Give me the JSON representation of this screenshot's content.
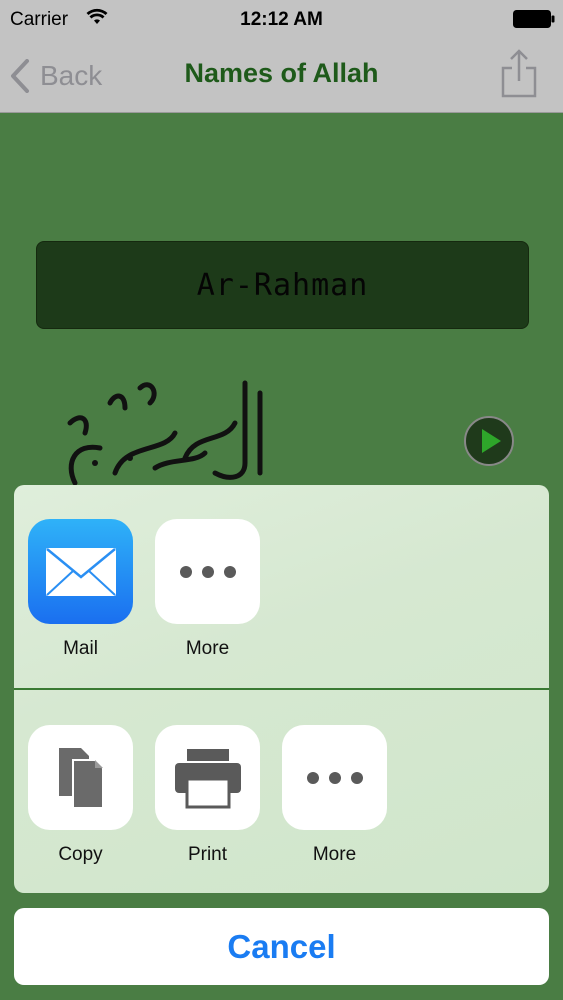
{
  "status": {
    "carrier": "Carrier",
    "time": "12:12 AM"
  },
  "nav": {
    "back_label": "Back",
    "title": "Names of Allah"
  },
  "content": {
    "name_label": "Ar-Rahman"
  },
  "share_sheet": {
    "top_row": [
      {
        "label": "Mail",
        "icon": "mail-icon"
      },
      {
        "label": "More",
        "icon": "more-dots-icon"
      }
    ],
    "bottom_row": [
      {
        "label": "Copy",
        "icon": "copy-icon"
      },
      {
        "label": "Print",
        "icon": "print-icon"
      },
      {
        "label": "More",
        "icon": "more-dots-icon"
      }
    ],
    "cancel_label": "Cancel"
  },
  "colors": {
    "background": "#4a7d44",
    "title": "#1e5a1a",
    "cancel": "#1a7cf2",
    "mail_gradient_top": "#2fb2f8",
    "mail_gradient_bottom": "#1a6ff0"
  }
}
